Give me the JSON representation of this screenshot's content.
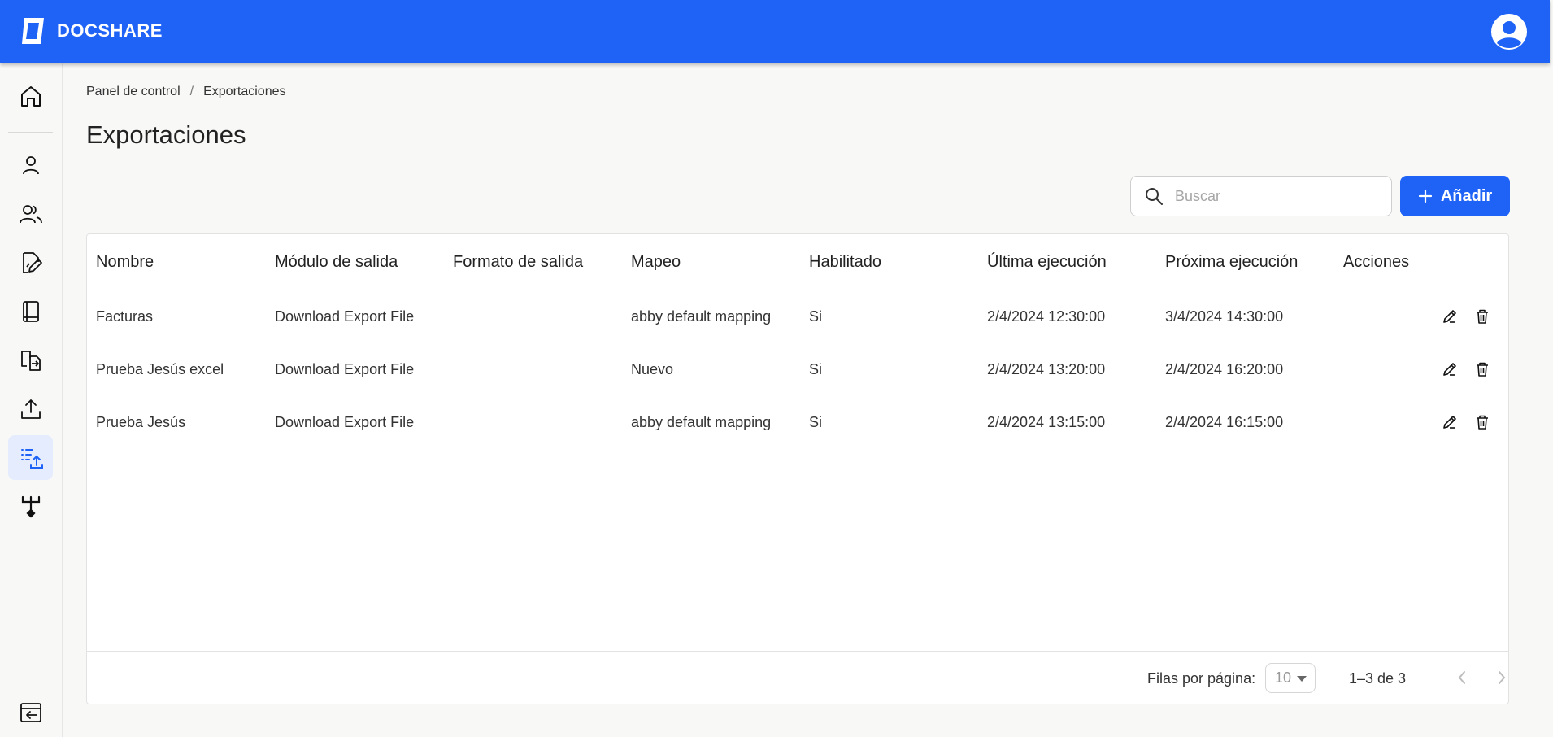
{
  "app": {
    "brand": "DOCSHARE"
  },
  "breadcrumb": {
    "root": "Panel de control",
    "separator": "/",
    "current": "Exportaciones"
  },
  "page": {
    "title": "Exportaciones"
  },
  "search": {
    "placeholder": "Buscar",
    "value": ""
  },
  "add_button": {
    "label": "Añadir",
    "icon": "plus-icon"
  },
  "table": {
    "columns": [
      "Nombre",
      "Módulo de salida",
      "Formato de salida",
      "Mapeo",
      "Habilitado",
      "Última ejecución",
      "Próxima ejecución",
      "Acciones"
    ],
    "rows": [
      {
        "nombre": "Facturas",
        "modulo": "Download Export File",
        "formato": "",
        "mapeo": "abby default mapping",
        "habilitado": "Si",
        "ultima": "2/4/2024 12:30:00",
        "proxima": "3/4/2024 14:30:00"
      },
      {
        "nombre": "Prueba Jesús excel",
        "modulo": "Download Export File",
        "formato": "",
        "mapeo": "Nuevo",
        "habilitado": "Si",
        "ultima": "2/4/2024 13:20:00",
        "proxima": "2/4/2024 16:20:00"
      },
      {
        "nombre": "Prueba Jesús",
        "modulo": "Download Export File",
        "formato": "",
        "mapeo": "abby default mapping",
        "habilitado": "Si",
        "ultima": "2/4/2024 13:15:00",
        "proxima": "2/4/2024 16:15:00"
      }
    ]
  },
  "pagination": {
    "rows_per_page_label": "Filas por página:",
    "rows_per_page": "10",
    "range": "1–3 de 3"
  },
  "sidebar": {
    "items": [
      "home-icon",
      "user-icon",
      "users-icon",
      "document-edit-icon",
      "book-icon",
      "file-transfer-icon",
      "upload-icon",
      "export-list-icon",
      "workflow-icon"
    ],
    "active": "export-list-icon",
    "bottom": "collapse-sidebar-icon"
  },
  "colors": {
    "primary": "#1f63f6",
    "active_bg": "#e4ecfd",
    "background": "#f8f8f7"
  }
}
